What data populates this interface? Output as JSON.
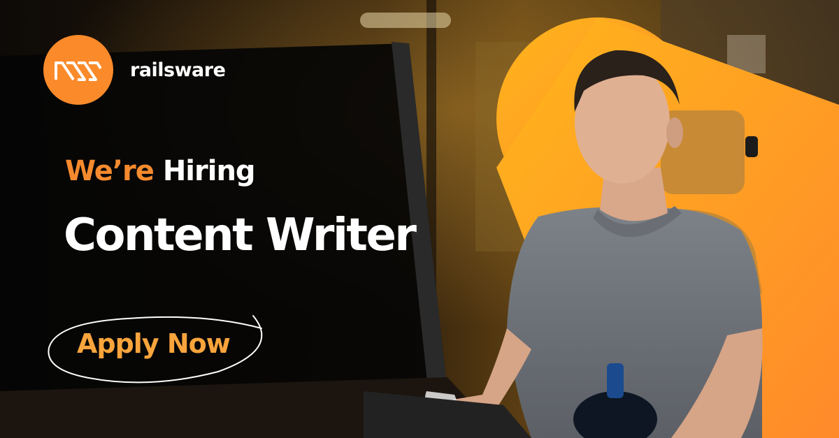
{
  "brand": {
    "name": "railsware",
    "logo_icon": "railsware-logo-icon",
    "color": "#fb8a2a"
  },
  "headline": {
    "accent": "We’re",
    "rest": "Hiring",
    "accent_color": "#f68a2e"
  },
  "role_title": "Content Writer",
  "cta": {
    "label": "Apply Now",
    "color": "#f9a43c"
  },
  "photo": {
    "subject": "man-at-computer-photo",
    "backdrop_color": "#ffa11a"
  }
}
